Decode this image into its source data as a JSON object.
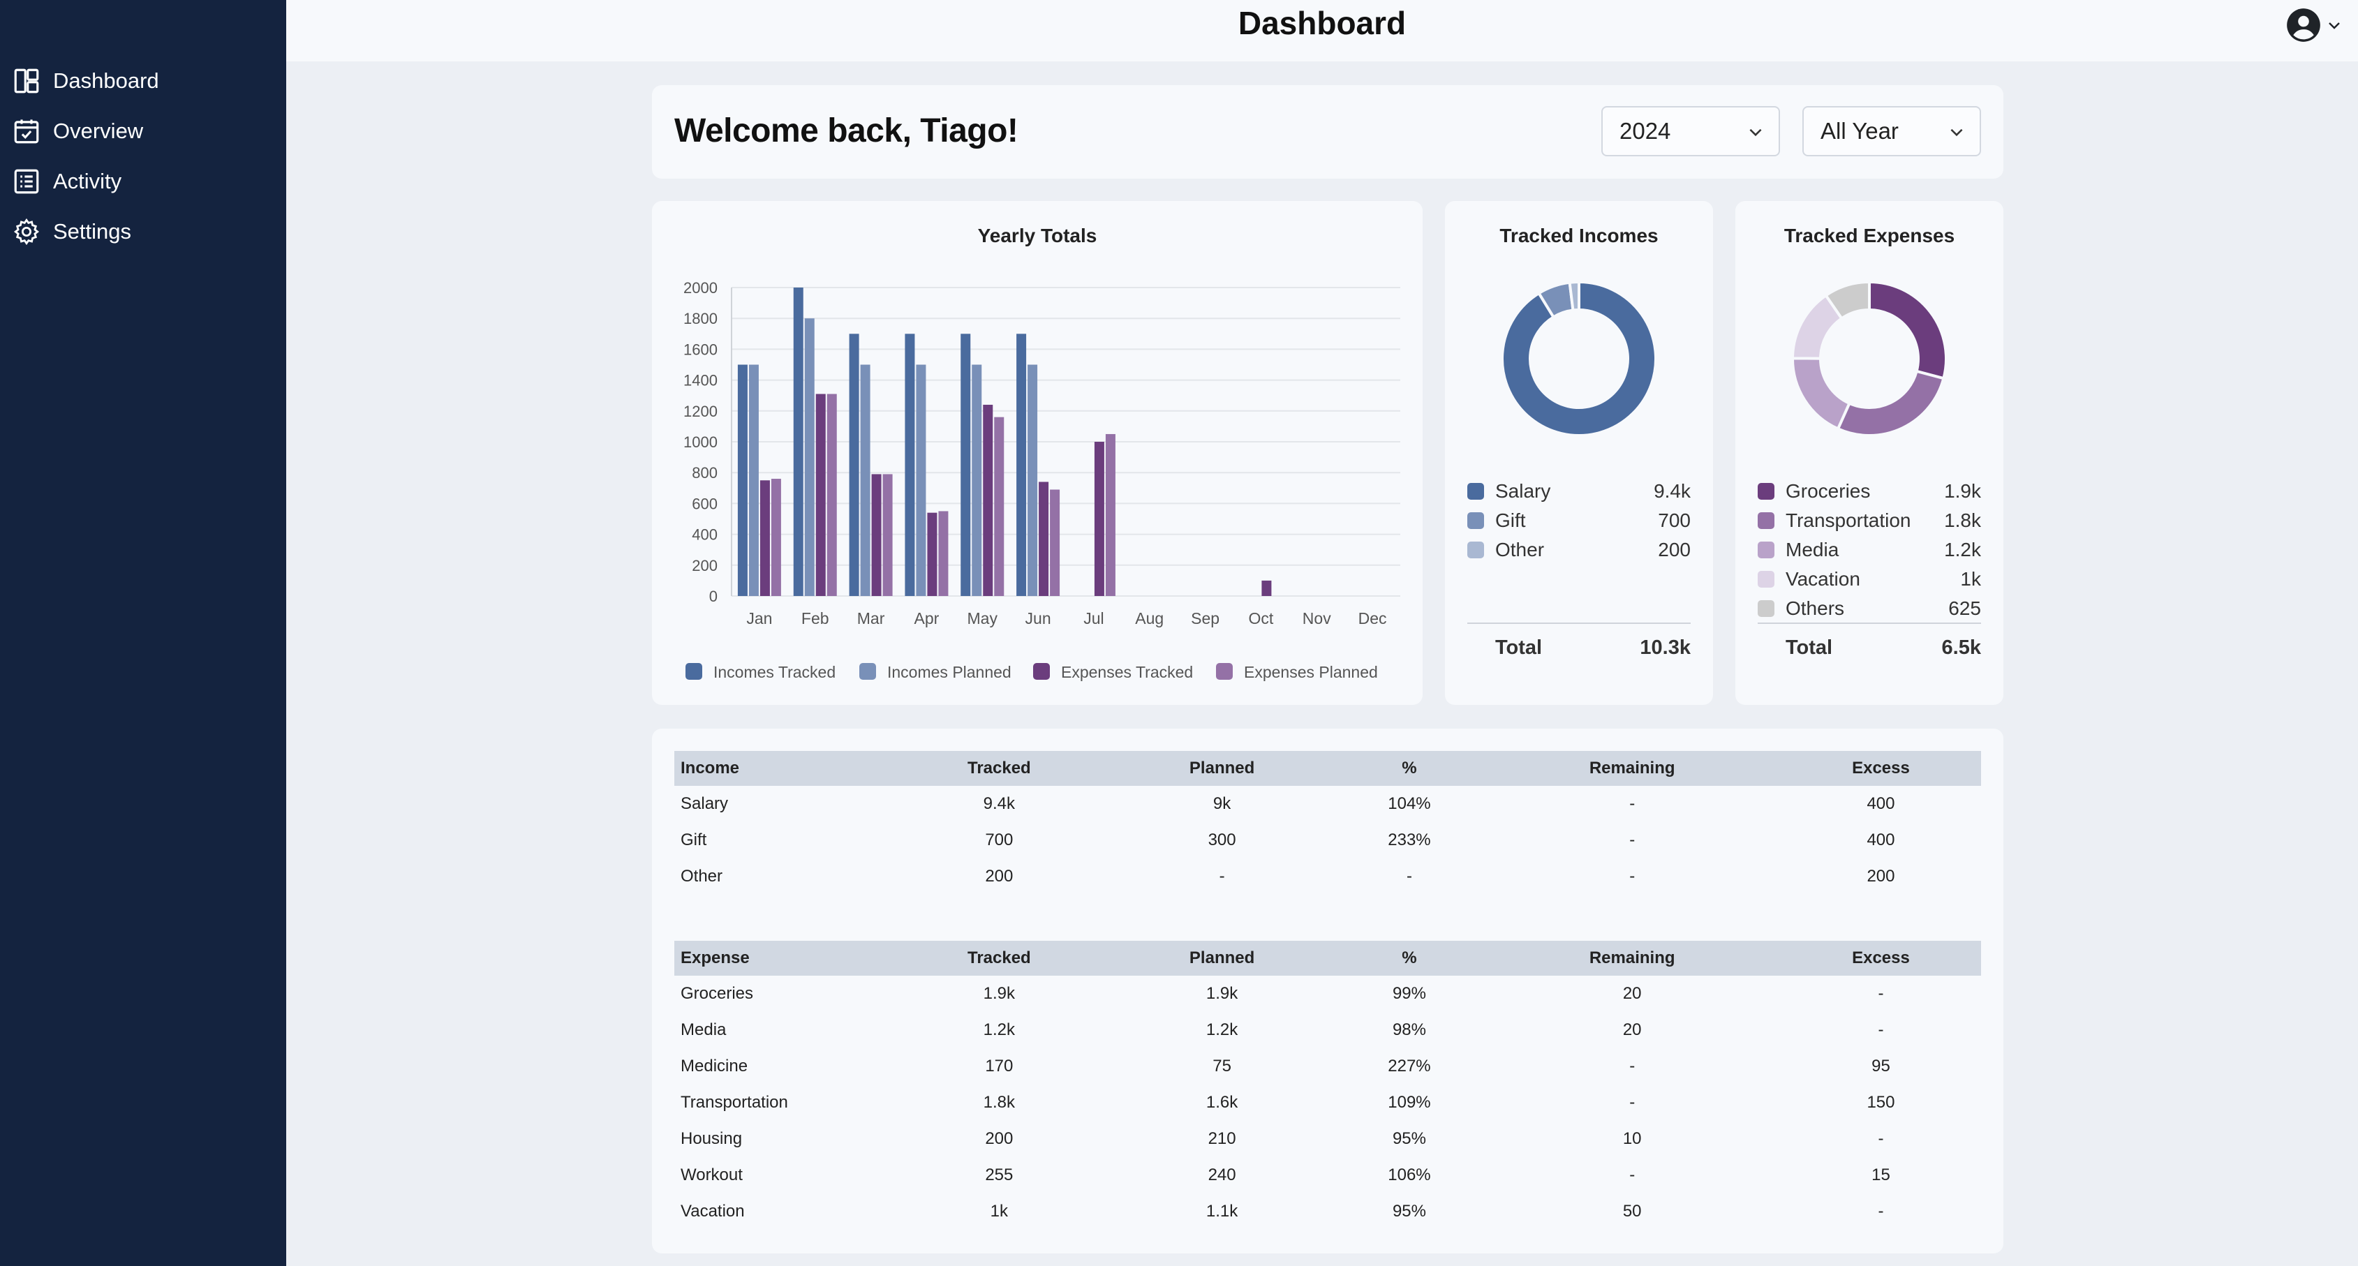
{
  "app": {
    "page_title": "Dashboard"
  },
  "sidebar": {
    "items": [
      {
        "label": "Dashboard",
        "icon": "dashboard-icon"
      },
      {
        "label": "Overview",
        "icon": "calendar-check-icon"
      },
      {
        "label": "Activity",
        "icon": "list-icon"
      },
      {
        "label": "Settings",
        "icon": "gear-icon"
      }
    ]
  },
  "header": {
    "welcome": "Welcome back, Tiago!",
    "year_select": "2024",
    "period_select": "All Year"
  },
  "colors": {
    "sidebar_bg": "#14233f",
    "incomes_tracked": "#4a6b9e",
    "incomes_planned": "#7990b8",
    "expenses_tracked": "#6b3d7d",
    "expenses_planned": "#9471a6"
  },
  "chart_data": {
    "type": "bar",
    "title": "Yearly Totals",
    "categories": [
      "Jan",
      "Feb",
      "Mar",
      "Apr",
      "May",
      "Jun",
      "Jul",
      "Aug",
      "Sep",
      "Oct",
      "Nov",
      "Dec"
    ],
    "series": [
      {
        "name": "Incomes Tracked",
        "color": "#4a6b9e",
        "values": [
          1500,
          2000,
          1700,
          1700,
          1700,
          1700,
          0,
          0,
          0,
          0,
          0,
          0
        ]
      },
      {
        "name": "Incomes Planned",
        "color": "#7990b8",
        "values": [
          1500,
          1800,
          1500,
          1500,
          1500,
          1500,
          0,
          0,
          0,
          0,
          0,
          0
        ]
      },
      {
        "name": "Expenses Tracked",
        "color": "#6b3d7d",
        "values": [
          750,
          1310,
          790,
          540,
          1240,
          740,
          1000,
          0,
          0,
          100,
          0,
          0
        ]
      },
      {
        "name": "Expenses Planned",
        "color": "#9471a6",
        "values": [
          760,
          1310,
          790,
          550,
          1160,
          690,
          1050,
          0,
          0,
          0,
          0,
          0
        ]
      }
    ],
    "ylim": [
      0,
      2000
    ],
    "yticks": [
      0,
      200,
      400,
      600,
      800,
      1000,
      1200,
      1400,
      1600,
      1800,
      2000
    ],
    "grid": true,
    "legend": "bottom"
  },
  "tracked_incomes": {
    "title": "Tracked Incomes",
    "type": "donut",
    "items": [
      {
        "label": "Salary",
        "value": "9.4k",
        "amount": 9400,
        "color": "#4a6b9e"
      },
      {
        "label": "Gift",
        "value": "700",
        "amount": 700,
        "color": "#7990b8"
      },
      {
        "label": "Other",
        "value": "200",
        "amount": 200,
        "color": "#a9b8d2"
      }
    ],
    "total_label": "Total",
    "total_value": "10.3k"
  },
  "tracked_expenses": {
    "title": "Tracked Expenses",
    "type": "donut",
    "items": [
      {
        "label": "Groceries",
        "value": "1.9k",
        "amount": 1900,
        "color": "#6b3d7d"
      },
      {
        "label": "Transportation",
        "value": "1.8k",
        "amount": 1800,
        "color": "#9471a6"
      },
      {
        "label": "Media",
        "value": "1.2k",
        "amount": 1200,
        "color": "#b9a2c9"
      },
      {
        "label": "Vacation",
        "value": "1k",
        "amount": 1000,
        "color": "#ddd3e6"
      },
      {
        "label": "Others",
        "value": "625",
        "amount": 625,
        "color": "#cccccc"
      }
    ],
    "total_label": "Total",
    "total_value": "6.5k"
  },
  "income_table": {
    "headers": [
      "Income",
      "Tracked",
      "Planned",
      "%",
      "Remaining",
      "Excess"
    ],
    "rows": [
      [
        "Salary",
        "9.4k",
        "9k",
        "104%",
        "-",
        "400"
      ],
      [
        "Gift",
        "700",
        "300",
        "233%",
        "-",
        "400"
      ],
      [
        "Other",
        "200",
        "-",
        "-",
        "-",
        "200"
      ]
    ]
  },
  "expense_table": {
    "headers": [
      "Expense",
      "Tracked",
      "Planned",
      "%",
      "Remaining",
      "Excess"
    ],
    "rows": [
      [
        "Groceries",
        "1.9k",
        "1.9k",
        "99%",
        "20",
        "-"
      ],
      [
        "Media",
        "1.2k",
        "1.2k",
        "98%",
        "20",
        "-"
      ],
      [
        "Medicine",
        "170",
        "75",
        "227%",
        "-",
        "95"
      ],
      [
        "Transportation",
        "1.8k",
        "1.6k",
        "109%",
        "-",
        "150"
      ],
      [
        "Housing",
        "200",
        "210",
        "95%",
        "10",
        "-"
      ],
      [
        "Workout",
        "255",
        "240",
        "106%",
        "-",
        "15"
      ],
      [
        "Vacation",
        "1k",
        "1.1k",
        "95%",
        "50",
        "-"
      ]
    ]
  }
}
